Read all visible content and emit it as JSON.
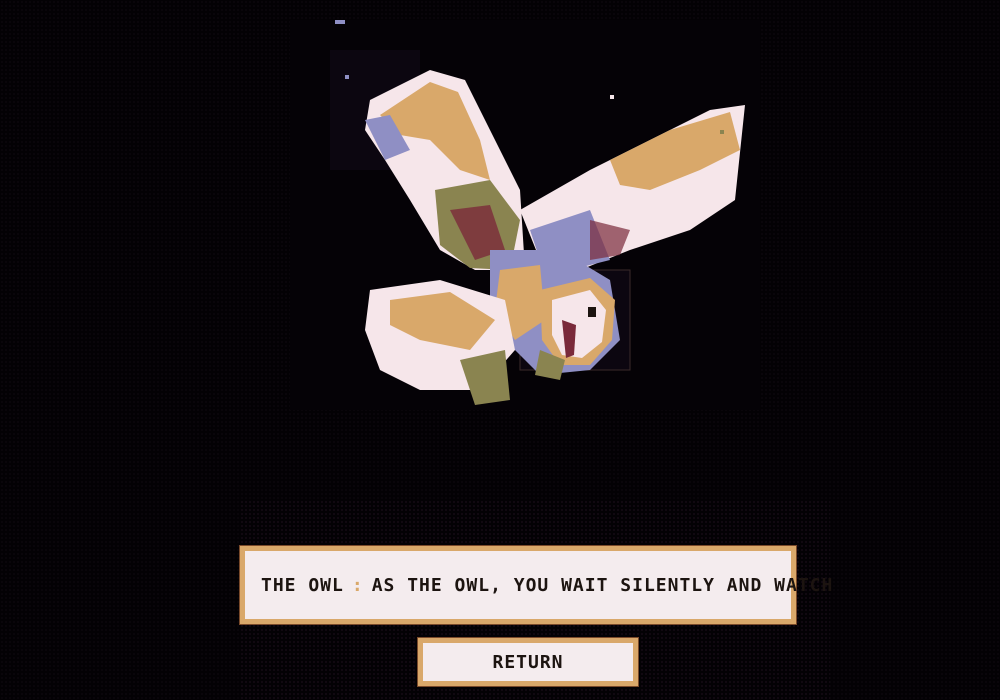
{
  "scene": {
    "illustration": "barn-owl-flying-icon"
  },
  "dialogue": {
    "speaker": "THE OWL",
    "separator": ":",
    "text": "AS THE OWL, YOU WAIT SILENTLY AND WATCH"
  },
  "controls": {
    "return_label": "RETURN"
  },
  "colors": {
    "background": "#030104",
    "panel": "#f4ecee",
    "border": "#d9a86a",
    "text": "#1c1410",
    "owl_cream": "#f6e6ea",
    "owl_tan": "#d9a86a",
    "owl_blue": "#8f8fc4",
    "owl_olive": "#8a8450",
    "owl_maroon": "#7a2a3a"
  }
}
